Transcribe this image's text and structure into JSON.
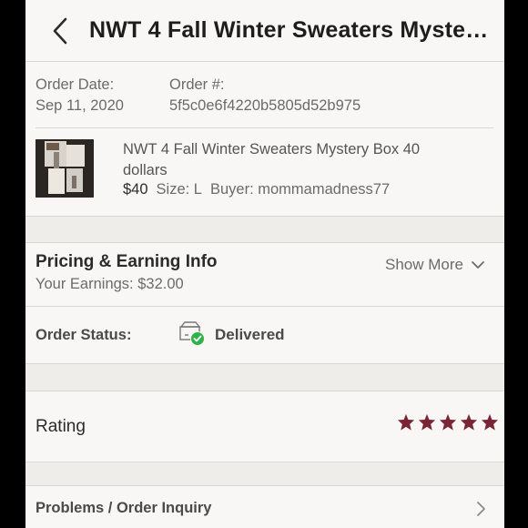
{
  "header": {
    "title": "NWT 4 Fall Winter Sweaters Myste…"
  },
  "order": {
    "date_label": "Order Date:",
    "date_value": "Sep 11, 2020",
    "number_label": "Order #:",
    "number_value": "5f5c0e6f4220b5805d52b975"
  },
  "item": {
    "title_line1": "NWT 4 Fall Winter Sweaters Mystery Box 40",
    "title_line2": "dollars",
    "price": "$40",
    "size": "Size: L",
    "buyer": "Buyer: mommamadness77"
  },
  "pricing": {
    "title": "Pricing & Earning Info",
    "earnings": "Your Earnings: $32.00",
    "show_more": "Show More"
  },
  "status": {
    "label": "Order Status:",
    "value": "Delivered"
  },
  "rating": {
    "label": "Rating",
    "stars": 5,
    "star_color": "#7a2535"
  },
  "problems": {
    "label": "Problems / Order Inquiry"
  },
  "colors": {
    "check_green": "#2fb24a",
    "text_gray": "#6b6b6b"
  }
}
